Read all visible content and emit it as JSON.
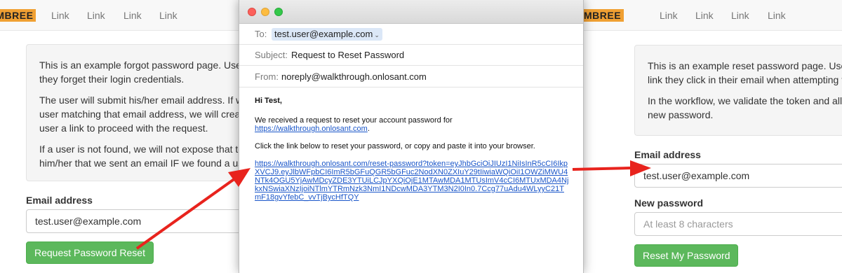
{
  "left_page": {
    "brand": "IMBREE",
    "nav_links": [
      "Link",
      "Link",
      "Link",
      "Link"
    ],
    "info_paragraphs": [
      [
        "This is an example forgot password page. Users w",
        "they forget their login credentials."
      ],
      [
        "The user will submit his/her email address. If we h",
        "user matching that email address, we will create a",
        "user a link to proceed with the request."
      ],
      [
        "If a user is not found, we will not expose that to th",
        "him/her that we sent an email IF we found a user."
      ]
    ],
    "email_label": "Email address",
    "email_value": "test.user@example.com",
    "submit_label": "Request Password Reset"
  },
  "right_page": {
    "brand": "MBREE",
    "nav_links": [
      "Link",
      "Link",
      "Link",
      "Link"
    ],
    "info_paragraphs": [
      [
        "This is an example reset password page. Users w",
        "link they click in their email when attempting to r"
      ],
      [
        "In the workflow, we validate the token and allow",
        "new password."
      ]
    ],
    "email_label": "Email address",
    "email_value": "test.user@example.com",
    "password_label": "New password",
    "password_placeholder": "At least 8 characters",
    "submit_label": "Reset My Password"
  },
  "mail": {
    "to_label": "To:",
    "to_value": "test.user@example.com",
    "subject_label": "Subject:",
    "subject_value": "Request to Reset Password",
    "from_label": "From:",
    "from_value": "noreply@walkthrough.onlosant.com",
    "greeting": "Hi Test,",
    "intro_text": "We received a request to reset your account password for",
    "site_link": "https://walkthrough.onlosant.com",
    "instruction": "Click the link below to reset your password, or copy and paste it into your browser.",
    "reset_link": "https://walkthrough.onlosant.com/reset-password?token=eyJhbGciOiJIUzI1NiIsInR5cCI6IkpXVCJ9.eyJlbWFpbCI6ImR5bGFuQGR5bGFuc2NodXN0ZXIuY29tIiwiaWQiOiI1OWZiMWU4NTk4OGU5YjAwMDcyZDE3YTUiLCJpYXQiOjE1MTAwMDA1MTUsImV4cCI6MTUxMDA4NjkxNSwiaXNzIjoiNTlmYTRmNzk3NmI1NDcwMDA3YTM3N2I0In0.7Ccg77uAdu4WLyyC21TmF18gvYfebC_vvTjBycHfTQY"
  },
  "colors": {
    "arrow": "#e8231d",
    "success_button": "#5cb85c",
    "brand_badge": "#f0a033",
    "link": "#1a56c9"
  }
}
